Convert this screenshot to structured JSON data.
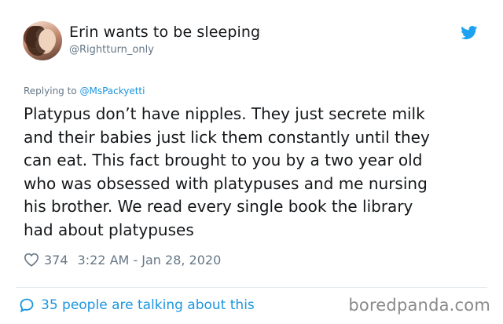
{
  "author": {
    "display_name": "Erin wants to be sleeping",
    "handle": "@Rightturn_only",
    "avatar_icon": "profile-photo"
  },
  "platform_icon": "twitter-bird-icon",
  "reply": {
    "prefix": "Replying to ",
    "mention": "@MsPackyetti"
  },
  "tweet_text": "Platypus don’t have nipples. They just secrete milk\nand their babies just lick them constantly until they\ncan eat. This fact brought to you by a two year old\nwho was obsessed with platypuses and me nursing\nhis brother. We read every single book the library\nhad about platypuses",
  "stats": {
    "like_icon": "heart-icon",
    "likes": "374",
    "timestamp": "3:22 AM - Jan 28, 2020"
  },
  "footer": {
    "talking_icon": "speech-bubble-icon",
    "talking_text": "35 people are talking about this",
    "watermark": "boredpanda.com"
  },
  "colors": {
    "accent": "#1b95e0",
    "muted": "#657786",
    "text": "#14171a",
    "divider": "#e6ecf0"
  }
}
